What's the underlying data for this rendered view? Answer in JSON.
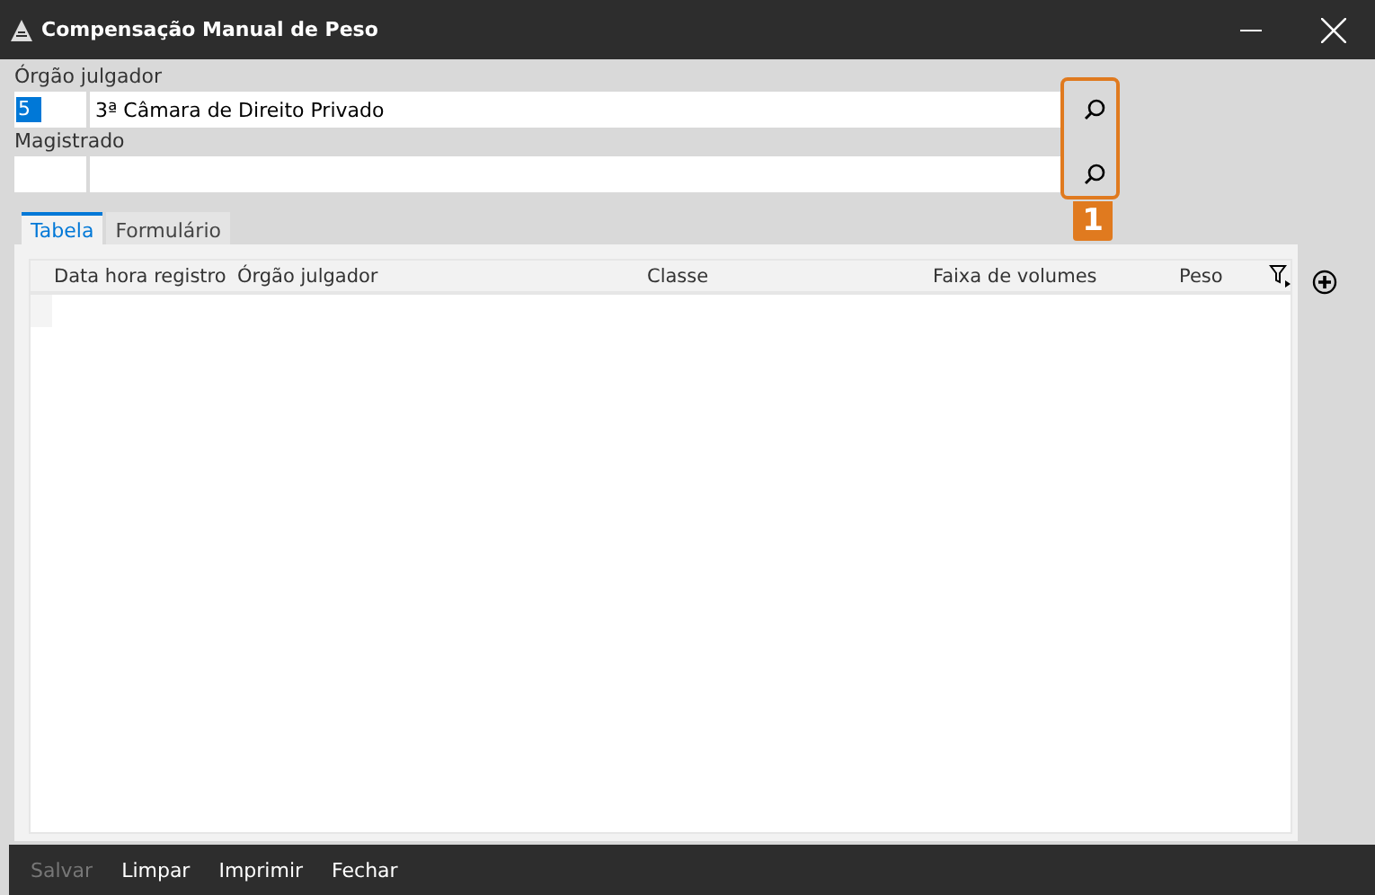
{
  "window": {
    "title": "Compensação Manual de Peso"
  },
  "fields": [
    {
      "label": "Órgão julgador",
      "code": "5",
      "code_selected": true,
      "value": "3ª Câmara de Direito Privado"
    },
    {
      "label": "Magistrado"
    }
  ],
  "annotation": {
    "label": "1"
  },
  "tabs": [
    {
      "label": "Tabela",
      "selected": true
    },
    {
      "label": "Formulário",
      "selected": false
    }
  ],
  "table": {
    "columns": [
      "Data hora registro",
      "Órgão julgador",
      "Classe",
      "Faixa de volumes",
      "Peso"
    ]
  },
  "buttons": [
    {
      "label": "Salvar",
      "disabled": true
    },
    {
      "label": "Limpar",
      "disabled": false
    },
    {
      "label": "Imprimir",
      "disabled": false
    },
    {
      "label": "Fechar",
      "disabled": false
    }
  ]
}
